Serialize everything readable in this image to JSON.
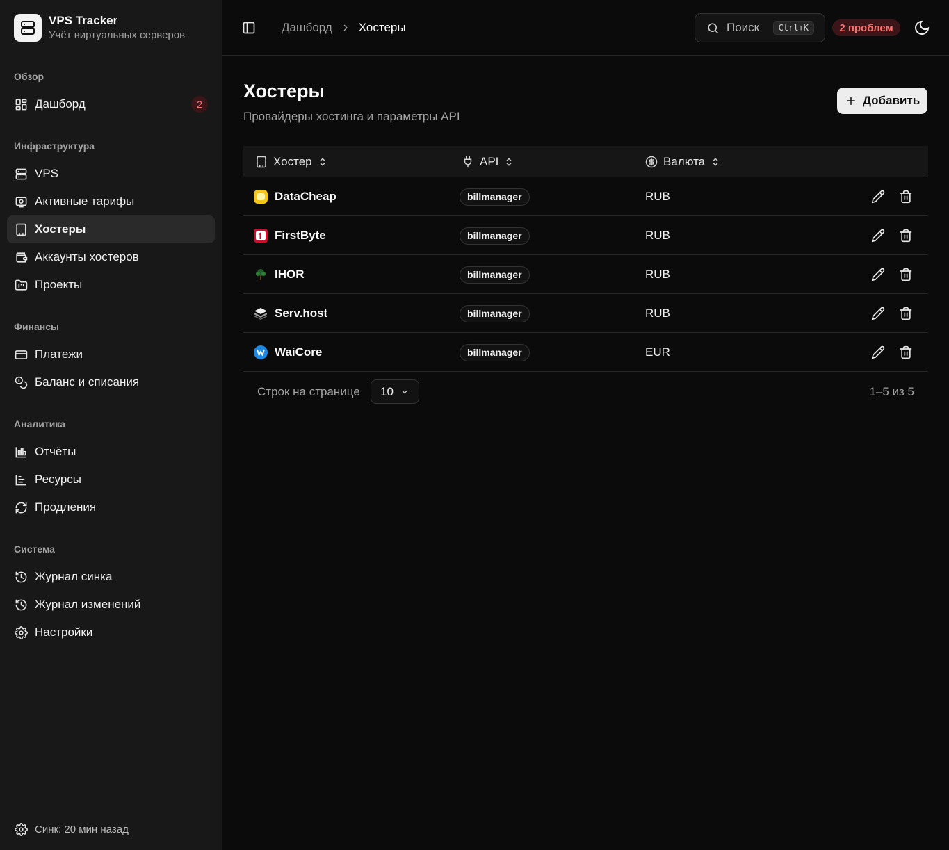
{
  "app": {
    "title": "VPS Tracker",
    "subtitle": "Учёт виртуальных серверов"
  },
  "sidebar": {
    "sections": [
      {
        "heading": "Обзор",
        "items": [
          {
            "label": "Дашборд",
            "icon": "layout-dashboard-icon",
            "badge": "2"
          }
        ]
      },
      {
        "heading": "Инфраструктура",
        "items": [
          {
            "label": "VPS",
            "icon": "server-icon"
          },
          {
            "label": "Активные тарифы",
            "icon": "tariff-icon"
          },
          {
            "label": "Хостеры",
            "icon": "building-icon",
            "active": true
          },
          {
            "label": "Аккаунты хостеров",
            "icon": "wallet-icon"
          },
          {
            "label": "Проекты",
            "icon": "folder-kanban-icon"
          }
        ]
      },
      {
        "heading": "Финансы",
        "items": [
          {
            "label": "Платежи",
            "icon": "credit-card-icon"
          },
          {
            "label": "Баланс и списания",
            "icon": "coins-icon"
          }
        ]
      },
      {
        "heading": "Аналитика",
        "items": [
          {
            "label": "Отчёты",
            "icon": "bar-chart-icon"
          },
          {
            "label": "Ресурсы",
            "icon": "chart-axis-icon"
          },
          {
            "label": "Продления",
            "icon": "refresh-icon"
          }
        ]
      },
      {
        "heading": "Система",
        "items": [
          {
            "label": "Журнал синка",
            "icon": "history-icon"
          },
          {
            "label": "Журнал изменений",
            "icon": "history-icon"
          },
          {
            "label": "Настройки",
            "icon": "gear-icon"
          }
        ]
      }
    ],
    "sync_status": "Синк: 20 мин назад"
  },
  "header": {
    "breadcrumb": {
      "parent": "Дашборд",
      "current": "Хостеры"
    },
    "search": {
      "placeholder": "Поиск",
      "shortcut": "Ctrl+K"
    },
    "problems": "2 проблем"
  },
  "page": {
    "title": "Хостеры",
    "subtitle": "Провайдеры хостинга и параметры API",
    "add_label": "Добавить"
  },
  "table": {
    "columns": {
      "host": "Хостер",
      "api": "API",
      "currency": "Валюта"
    },
    "rows": [
      {
        "name": "DataCheap",
        "api": "billmanager",
        "currency": "RUB",
        "logo": "datacheap-logo"
      },
      {
        "name": "FirstByte",
        "api": "billmanager",
        "currency": "RUB",
        "logo": "firstbyte-logo"
      },
      {
        "name": "IHOR",
        "api": "billmanager",
        "currency": "RUB",
        "logo": "ihor-logo"
      },
      {
        "name": "Serv.host",
        "api": "billmanager",
        "currency": "RUB",
        "logo": "servhost-logo"
      },
      {
        "name": "WaiCore",
        "api": "billmanager",
        "currency": "EUR",
        "logo": "waicore-logo"
      }
    ]
  },
  "pagination": {
    "rows_label": "Строк на странице",
    "page_size": "10",
    "range": "1–5 из 5"
  },
  "colors": {
    "accent_danger": "#f87171",
    "danger_bg": "#3b1517",
    "sidebar_bg": "#181818",
    "page_bg": "#0b0b0b"
  }
}
